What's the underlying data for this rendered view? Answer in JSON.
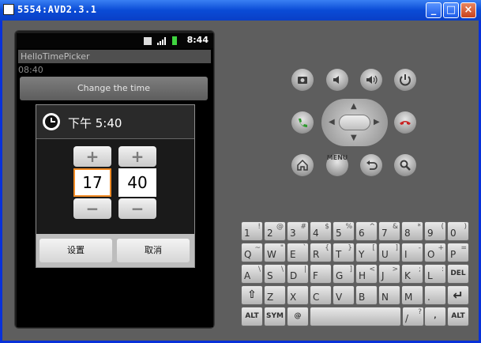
{
  "window": {
    "title": "5554:AVD2.3.1",
    "min": "_",
    "max": "□",
    "close": "×"
  },
  "status": {
    "time": "8:44"
  },
  "app": {
    "title": "HelloTimePicker",
    "time_text": "08:40",
    "change_button": "Change the time"
  },
  "dialog": {
    "title": "下午 5:40",
    "hour": "17",
    "minute": "40",
    "plus": "+",
    "minus": "−",
    "set_button": "设置",
    "cancel_button": "取消"
  },
  "controls": {
    "camera": "camera-icon",
    "vol_down": "volume-down-icon",
    "vol_up": "volume-up-icon",
    "power": "power-icon",
    "call": "call-icon",
    "end_call": "end-call-icon",
    "home": "home-icon",
    "menu": "MENU",
    "back": "back-icon",
    "search": "search-icon"
  },
  "keyboard": {
    "row1": [
      [
        "1",
        "!"
      ],
      [
        "2",
        "@"
      ],
      [
        "3",
        "#"
      ],
      [
        "4",
        "$"
      ],
      [
        "5",
        "%"
      ],
      [
        "6",
        "^"
      ],
      [
        "7",
        "&"
      ],
      [
        "8",
        "*"
      ],
      [
        "9",
        "("
      ],
      [
        "0",
        ")"
      ]
    ],
    "row2": [
      [
        "Q",
        "~"
      ],
      [
        "W",
        "\""
      ],
      [
        "E",
        "`"
      ],
      [
        "R",
        "{"
      ],
      [
        "T",
        "}"
      ],
      [
        "Y",
        "["
      ],
      [
        "U",
        "]"
      ],
      [
        "I",
        "-"
      ],
      [
        "O",
        "+"
      ],
      [
        "P",
        "="
      ]
    ],
    "row3": [
      [
        "A",
        "\\"
      ],
      [
        "S",
        "\\"
      ],
      [
        "D",
        "|"
      ],
      [
        "F",
        ""
      ],
      [
        "G",
        "]"
      ],
      [
        "H",
        "<"
      ],
      [
        "J",
        ">"
      ],
      [
        "K",
        ";"
      ],
      [
        "L",
        ":"
      ]
    ],
    "row3_del": "DEL",
    "row4": [
      [
        "Z",
        ""
      ],
      [
        "X",
        ""
      ],
      [
        "C",
        ""
      ],
      [
        "V",
        ""
      ],
      [
        "B",
        ""
      ],
      [
        "N",
        ""
      ],
      [
        "M",
        ""
      ],
      [
        ".",
        ""
      ]
    ],
    "row5_alt": "ALT",
    "row5_sym": "SYM",
    "row5_at": "@",
    "row5_slash": "/",
    "row5_comma": ",",
    "row5_q": "?"
  }
}
